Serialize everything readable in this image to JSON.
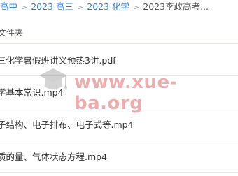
{
  "breadcrumb": {
    "items": [
      "高中",
      "2023 高三",
      "2023 化学"
    ],
    "current": "2023李政高考...",
    "separator": ">"
  },
  "section": {
    "label": "文件夹"
  },
  "files": [
    {
      "name": "三化学暑假班讲义预热3讲.pdf"
    },
    {
      "name": "学基本常识.mp4"
    },
    {
      "name": "子结构、电子排布、电子式等.mp4"
    },
    {
      "name": "质的量、气体状态方程.mp4"
    }
  ],
  "watermark": {
    "text": "www.xue-ba.org",
    "icon": "graduation-cap-icon",
    "color": "#d63c3c"
  },
  "colors": {
    "link": "#2f7fd8",
    "divider": "#e6e9ee"
  }
}
